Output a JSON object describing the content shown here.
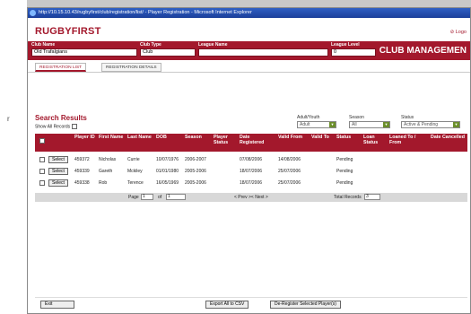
{
  "left_fragment": "r",
  "window": {
    "title": "http://10.15.10.43/rugbyfirst/club/registration/list/  - Player Registration - Microsoft Internet Explorer"
  },
  "header": {
    "logo_part1": "RUGBY",
    "logo_part2": "FIRST",
    "logout": "Logo"
  },
  "club_bar": {
    "club_name_label": "Club Name",
    "club_name_value": "Old Trafalgians",
    "club_type_label": "Club Type",
    "club_type_value": "Club",
    "league_name_label": "League Name",
    "league_name_value": "",
    "league_level_label": "League Level",
    "league_level_value": "0",
    "section_title": "CLUB MANAGEMEN"
  },
  "tabs": [
    {
      "label": "REGISTRATION LIST"
    },
    {
      "label": "REGISTRATION DETAILS"
    }
  ],
  "results": {
    "title": "Search Results",
    "show_all_label": "Show All Records",
    "filters": {
      "adult_youth_label": "Adult/Youth",
      "adult_youth_value": "Adult",
      "season_label": "Season",
      "season_value": "All",
      "status_label": "Status",
      "status_value": "Active & Pending"
    },
    "columns": [
      "Player ID",
      "First Name",
      "Last Name",
      "DOB",
      "Season",
      "Player Status",
      "Date Registered",
      "Valid From",
      "Valid To",
      "Status",
      "Loan Status",
      "Loaned To / From",
      "Date Cancelled"
    ],
    "select_label": "Select",
    "rows": [
      {
        "player_id": "459372",
        "first_name": "Nicholas",
        "last_name": "Currie",
        "dob": "10/07/1976",
        "season": "2006-2007",
        "player_status": "",
        "date_registered": "07/08/2006",
        "valid_from": "14/08/2006",
        "valid_to": "",
        "status": "Pending",
        "loan_status": "",
        "loaned": "",
        "date_cancelled": ""
      },
      {
        "player_id": "459339",
        "first_name": "Gareth",
        "last_name": "Mckiley",
        "dob": "01/01/1980",
        "season": "2005-2006",
        "player_status": "",
        "date_registered": "18/07/2006",
        "valid_from": "25/07/2006",
        "valid_to": "",
        "status": "Pending",
        "loan_status": "",
        "loaned": "",
        "date_cancelled": ""
      },
      {
        "player_id": "459338",
        "first_name": "Rob",
        "last_name": "Terence",
        "dob": "16/05/1969",
        "season": "2005-2006",
        "player_status": "",
        "date_registered": "18/07/2006",
        "valid_from": "25/07/2006",
        "valid_to": "",
        "status": "Pending",
        "loan_status": "",
        "loaned": "",
        "date_cancelled": ""
      }
    ],
    "pager": {
      "page_label": "Page",
      "page_value": "1",
      "of_label": "of",
      "of_value": "1",
      "nav": "< Prev >< Next >",
      "total_label": "Total Records",
      "total_value": "3"
    }
  },
  "footer": {
    "exit_label": "Exit",
    "export_label": "Export All to CSV",
    "deregister_label": "De-Register Selected Player(s)"
  },
  "colors": {
    "brand_red": "#a3182c",
    "titlebar_blue": "#1b3f9a",
    "select_arrow_green": "#6b8e2a"
  }
}
